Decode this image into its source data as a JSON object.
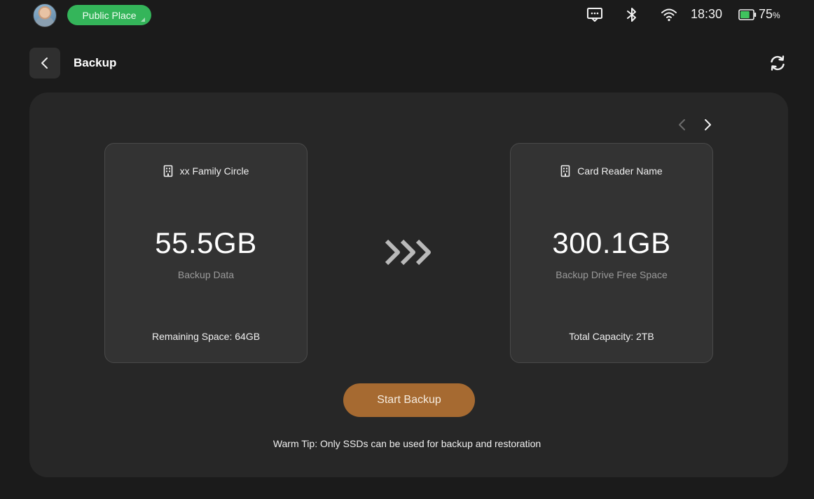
{
  "status_bar": {
    "place_label": "Public Place",
    "time": "18:30",
    "battery_value": "75",
    "battery_unit": "%",
    "battery_level": 0.75,
    "icons": [
      "message-icon",
      "bluetooth-icon",
      "wifi-icon",
      "battery-icon"
    ]
  },
  "header": {
    "title": "Backup"
  },
  "source_card": {
    "name": "xx Family Circle",
    "value": "55.5GB",
    "caption": "Backup Data",
    "footer": "Remaining Space: 64GB"
  },
  "target_card": {
    "name": "Card Reader Name",
    "value": "300.1GB",
    "caption": "Backup Drive Free Space",
    "footer": "Total Capacity: 2TB"
  },
  "actions": {
    "start_label": "Start Backup"
  },
  "tip": "Warm Tip: Only SSDs can be used for backup and restoration",
  "colors": {
    "background": "#1b1b1b",
    "panel": "#272727",
    "card": "#333333",
    "accent_button": "#a66a31",
    "place_pill": "#34b55a",
    "battery_fill": "#3fc35e"
  }
}
